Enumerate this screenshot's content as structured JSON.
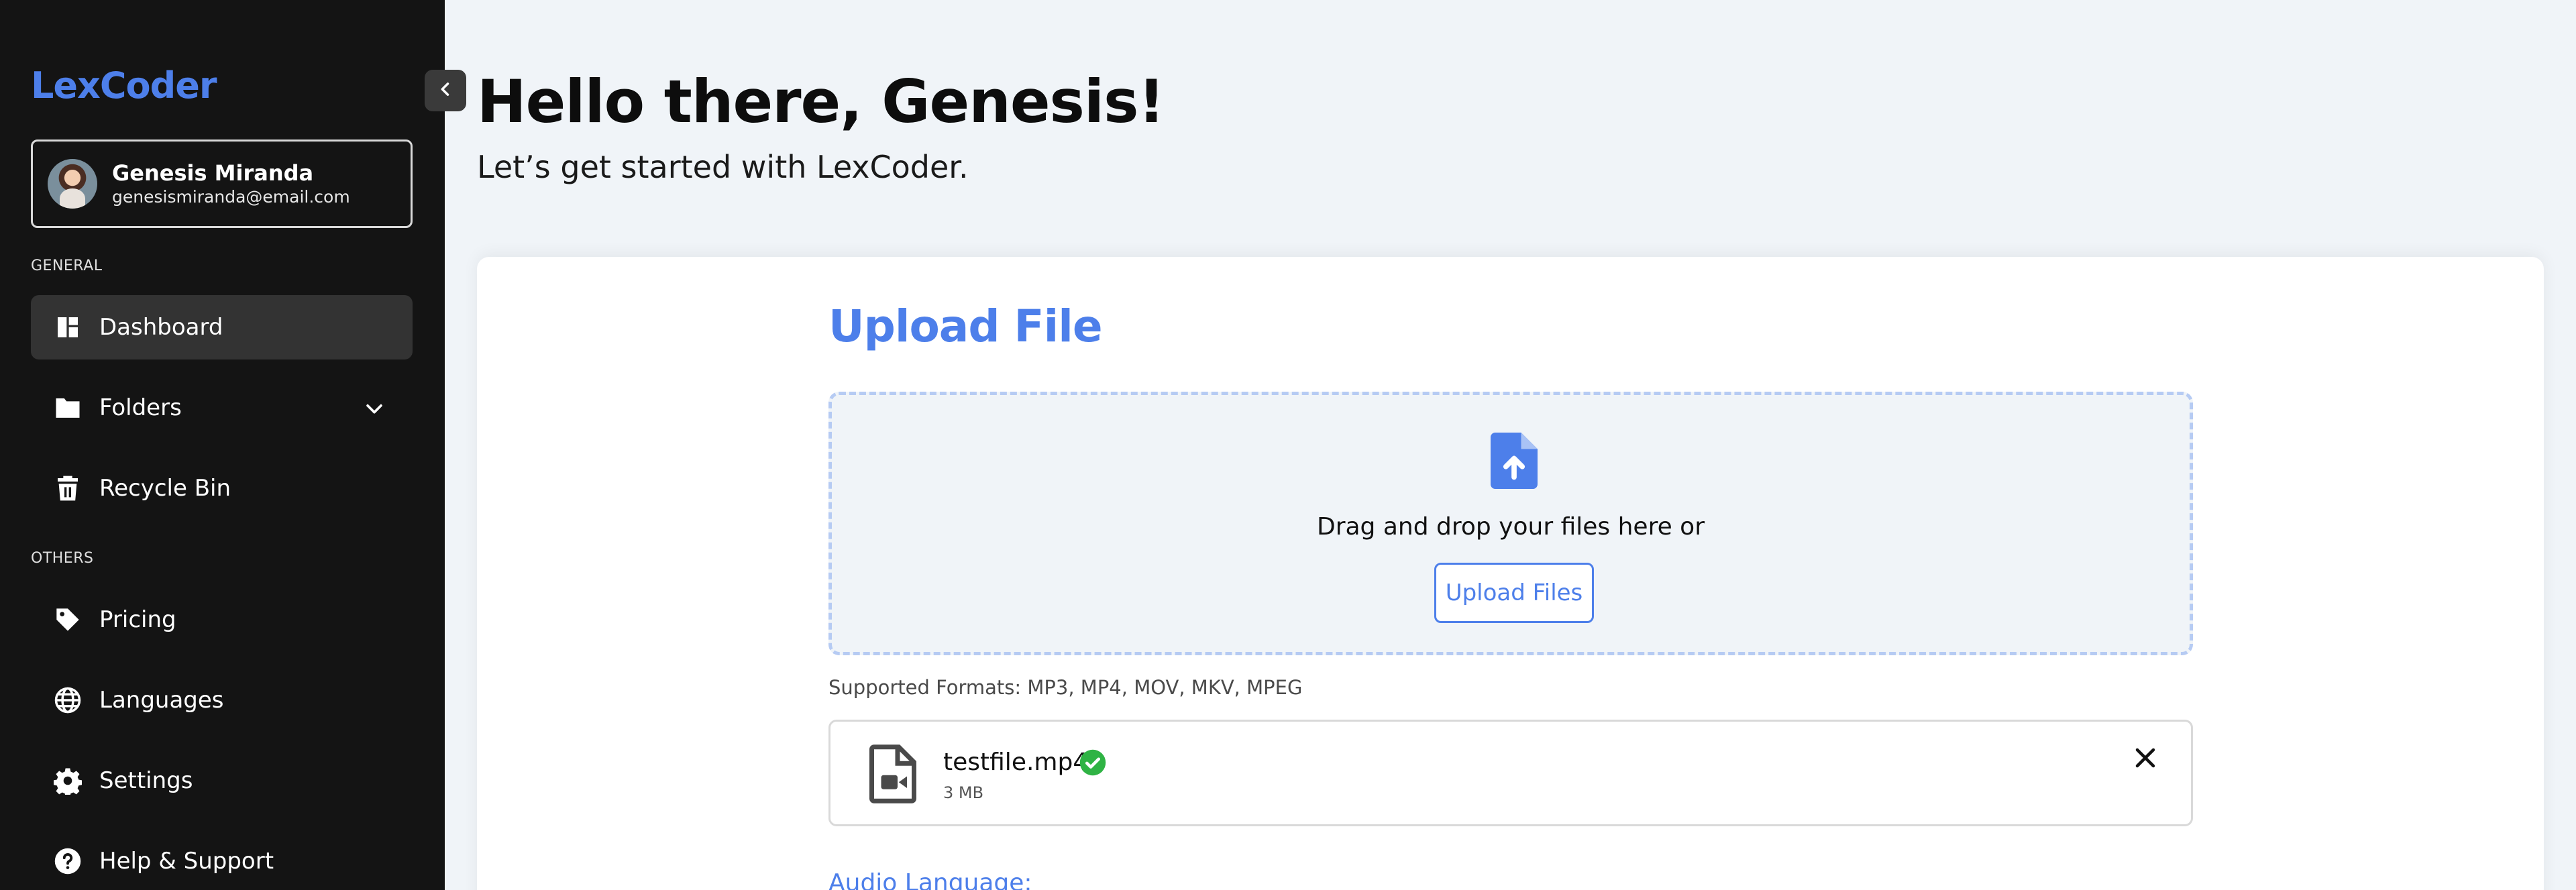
{
  "sidebar": {
    "brand": "LexCoder",
    "user": {
      "name": "Genesis Miranda",
      "email": "genesismiranda@email.com"
    },
    "sections": {
      "general": "GENERAL",
      "others": "OTHERS"
    },
    "items": [
      {
        "label": "Dashboard",
        "icon": "dashboard-icon",
        "active": true
      },
      {
        "label": "Folders",
        "icon": "folder-icon",
        "expandable": true
      },
      {
        "label": "Recycle Bin",
        "icon": "trash-icon"
      },
      {
        "label": "Pricing",
        "icon": "tag-icon"
      },
      {
        "label": "Languages",
        "icon": "globe-icon"
      },
      {
        "label": "Settings",
        "icon": "gear-icon"
      },
      {
        "label": "Help & Support",
        "icon": "help-icon"
      }
    ]
  },
  "header": {
    "greeting": "Hello there, Genesis!",
    "subtitle": "Let’s get started with LexCoder."
  },
  "upload": {
    "title": "Upload File",
    "drop_text": "Drag and drop your files here or",
    "button_label": "Upload Files",
    "formats": "Supported Formats: MP3, MP4, MOV, MKV, MPEG",
    "file": {
      "name": "testfile.mp4",
      "size": "3 MB",
      "status": "uploaded"
    },
    "audio_language_label": "Audio Language:"
  },
  "colors": {
    "accent": "#4d7fea",
    "sidebar_bg": "#141414",
    "page_bg": "#f0f4f8",
    "success": "#2fb344"
  }
}
